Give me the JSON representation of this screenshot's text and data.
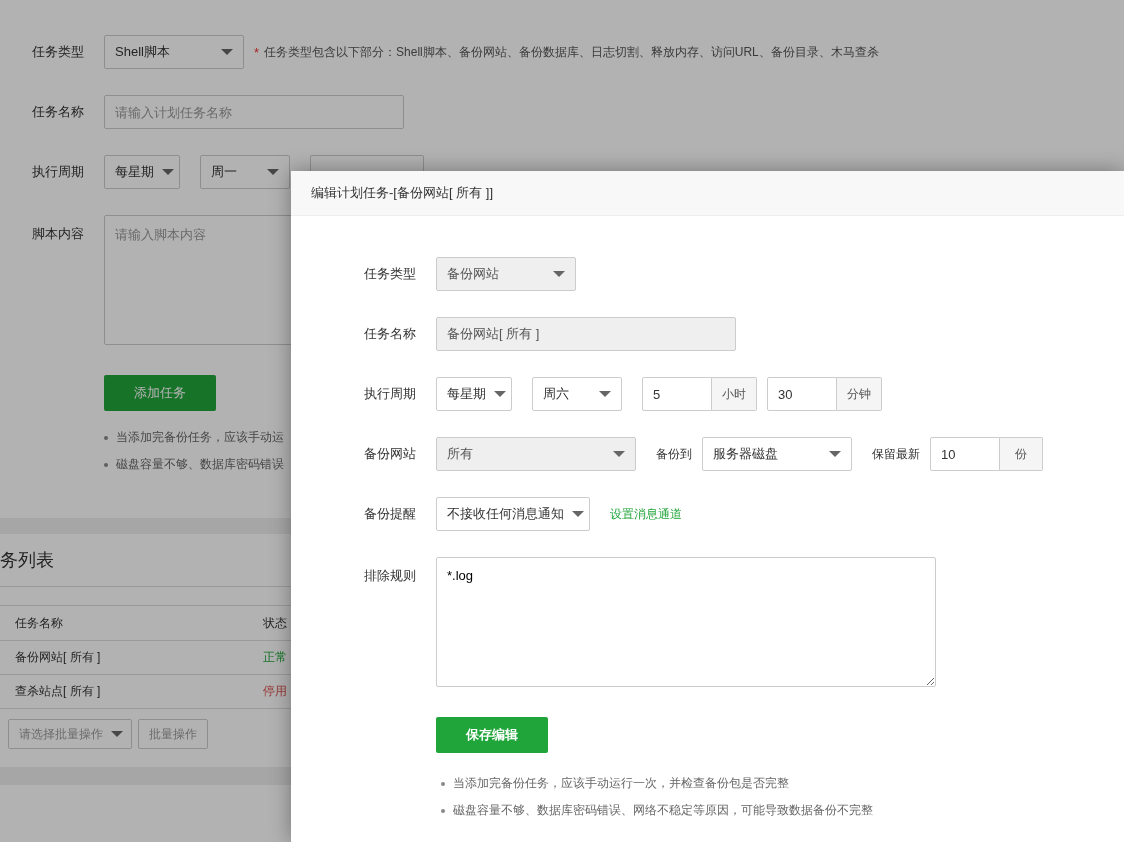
{
  "background": {
    "type_label": "任务类型",
    "type_select": "Shell脚本",
    "hint_mark": "*",
    "type_hint": "任务类型包含以下部分：Shell脚本、备份网站、备份数据库、日志切割、释放内存、访问URL、备份目录、木马查杀",
    "name_label": "任务名称",
    "name_placeholder": "请输入计划任务名称",
    "cycle_label": "执行周期",
    "cycle_selects": [
      "每星期",
      "周一"
    ],
    "script_label": "脚本内容",
    "script_placeholder": "请输入脚本内容",
    "add_button": "添加任务",
    "notes": [
      "当添加完备份任务，应该手动运",
      "磁盘容量不够、数据库密码错误"
    ],
    "list_title": "务列表",
    "table": {
      "columns": [
        "任务名称",
        "状态"
      ],
      "rows": [
        {
          "name": "备份网站[ 所有 ]",
          "status": "正常",
          "kind": "active"
        },
        {
          "name": "查杀站点[ 所有 ]",
          "status": "停用",
          "kind": "stopped"
        }
      ]
    },
    "batch_select": {
      "placeholder": "请选择批量操作"
    },
    "batch_button": "批量操作"
  },
  "dialog": {
    "title": "编辑计划任务-[备份网站[ 所有 ]]",
    "type_label": "任务类型",
    "type_select": {
      "value": "备份网站",
      "disabled": true
    },
    "name_label": "任务名称",
    "name_field": {
      "value": "备份网站[ 所有 ]",
      "disabled": true
    },
    "cycle_label": "执行周期",
    "cycle_selects": [
      {
        "value": "每星期",
        "disabled": false
      },
      {
        "value": "周六",
        "disabled": false
      }
    ],
    "hour_field": {
      "value": "5",
      "unit": "小时"
    },
    "minute_field": {
      "value": "30",
      "unit": "分钟"
    },
    "site_label": "备份网站",
    "site_select": {
      "value": "所有",
      "disabled": true
    },
    "target_label": "备份到",
    "target_select": {
      "value": "服务器磁盘",
      "disabled": false
    },
    "keep_label": "保留最新",
    "keep_field": {
      "value": "10",
      "unit": "份"
    },
    "notify_label": "备份提醒",
    "notify_select": {
      "value": "不接收任何消息通知",
      "disabled": false
    },
    "notify_link": "设置消息通道",
    "exclude_label": "排除规则",
    "exclude_value": "*.log",
    "save_button": "保存编辑",
    "notes": [
      "当添加完备份任务，应该手动运行一次，并检查备份包是否完整",
      "磁盘容量不够、数据库密码错误、网络不稳定等原因，可能导致数据备份不完整"
    ]
  }
}
